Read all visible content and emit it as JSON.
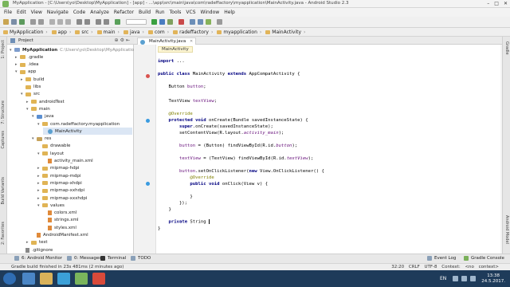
{
  "window": {
    "title": "MyApplication - [C:\\Users\\yo\\Desktop\\MyApplication] - [app] - ...\\app\\src\\main\\java\\com\\radeffactory\\myapplication\\MainActivity.java - Android Studio 2.3"
  },
  "menu": [
    "File",
    "Edit",
    "View",
    "Navigate",
    "Code",
    "Analyze",
    "Refactor",
    "Build",
    "Run",
    "Tools",
    "VCS",
    "Window",
    "Help"
  ],
  "breadcrumb": [
    "MyApplication",
    "app",
    "src",
    "main",
    "java",
    "com",
    "radeffactory",
    "myapplication",
    "MainActivity"
  ],
  "project_panel": {
    "header": "Project",
    "tree": [
      {
        "label": "MyApplication",
        "path": "C:\\Users\\yo\\Desktop\\MyApplication",
        "depth": 0,
        "type": "module",
        "arrow": "▾"
      },
      {
        "label": ".gradle",
        "depth": 1,
        "type": "folder",
        "arrow": "▸"
      },
      {
        "label": ".idea",
        "depth": 1,
        "type": "folder",
        "arrow": "▸"
      },
      {
        "label": "app",
        "depth": 1,
        "type": "folder",
        "arrow": "▾"
      },
      {
        "label": "build",
        "depth": 2,
        "type": "folder",
        "arrow": "▸"
      },
      {
        "label": "libs",
        "depth": 2,
        "type": "folder",
        "arrow": ""
      },
      {
        "label": "src",
        "depth": 2,
        "type": "folder",
        "arrow": "▾"
      },
      {
        "label": "androidTest",
        "depth": 3,
        "type": "folder",
        "arrow": "▸"
      },
      {
        "label": "main",
        "depth": 3,
        "type": "folder",
        "arrow": "▾"
      },
      {
        "label": "java",
        "depth": 4,
        "type": "java",
        "arrow": "▾"
      },
      {
        "label": "com.radeffactory.myapplication",
        "depth": 5,
        "type": "package",
        "arrow": "▾"
      },
      {
        "label": "MainActivity",
        "depth": 6,
        "type": "class",
        "arrow": "",
        "selected": true
      },
      {
        "label": "res",
        "depth": 4,
        "type": "res",
        "arrow": "▾"
      },
      {
        "label": "drawable",
        "depth": 5,
        "type": "folder",
        "arrow": ""
      },
      {
        "label": "layout",
        "depth": 5,
        "type": "folder",
        "arrow": "▾"
      },
      {
        "label": "activity_main.xml",
        "depth": 6,
        "type": "xml",
        "arrow": ""
      },
      {
        "label": "mipmap-hdpi",
        "depth": 5,
        "type": "folder",
        "arrow": "▸"
      },
      {
        "label": "mipmap-mdpi",
        "depth": 5,
        "type": "folder",
        "arrow": "▸"
      },
      {
        "label": "mipmap-xhdpi",
        "depth": 5,
        "type": "folder",
        "arrow": "▸"
      },
      {
        "label": "mipmap-xxhdpi",
        "depth": 5,
        "type": "folder",
        "arrow": "▸"
      },
      {
        "label": "mipmap-xxxhdpi",
        "depth": 5,
        "type": "folder",
        "arrow": "▸"
      },
      {
        "label": "values",
        "depth": 5,
        "type": "folder",
        "arrow": "▾"
      },
      {
        "label": "colors.xml",
        "depth": 6,
        "type": "xml",
        "arrow": ""
      },
      {
        "label": "strings.xml",
        "depth": 6,
        "type": "xml",
        "arrow": ""
      },
      {
        "label": "styles.xml",
        "depth": 6,
        "type": "xml",
        "arrow": ""
      },
      {
        "label": "AndroidManifest.xml",
        "depth": 4,
        "type": "xml",
        "arrow": ""
      },
      {
        "label": "test",
        "depth": 3,
        "type": "folder",
        "arrow": "▸"
      },
      {
        "label": ".gitignore",
        "depth": 2,
        "type": "git",
        "arrow": ""
      }
    ]
  },
  "editor": {
    "tab": "MainActivity.java",
    "context_tag": "MainActivity",
    "lines": [
      {
        "html": "<span class='kw'>import</span> ..."
      },
      {
        "html": ""
      },
      {
        "html": "<span class='kw'>public class</span> MainActivity <span class='kw'>extends</span> AppCompatActivity {"
      },
      {
        "html": ""
      },
      {
        "html": "    Button <span class='fd'>button</span>;"
      },
      {
        "html": ""
      },
      {
        "html": "    TextView <span class='fd'>textView</span>;"
      },
      {
        "html": ""
      },
      {
        "html": "    <span class='an'>@Override</span>"
      },
      {
        "html": "    <span class='kw'>protected void</span> onCreate(Bundle savedInstanceState) {"
      },
      {
        "html": "        <span class='kw'>super</span>.onCreate(savedInstanceState);"
      },
      {
        "html": "        setContentView(R.layout.<span class='st'>activity_main</span>);"
      },
      {
        "html": ""
      },
      {
        "html": "        <span class='fd'>button</span> = (Button) findViewById(R.id.<span class='st'>button</span>);"
      },
      {
        "html": ""
      },
      {
        "html": "        <span class='fd'>textView</span> = (TextView) findViewById(R.id.<span class='st'>textView</span>);"
      },
      {
        "html": ""
      },
      {
        "html": "        <span class='fd'>button</span>.setOnClickListener(<span class='kw'>new</span> View.OnClickListener() {"
      },
      {
        "html": "            <span class='an'>@Override</span>"
      },
      {
        "html": "            <span class='kw'>public void</span> onClick(View v) {"
      },
      {
        "html": ""
      },
      {
        "html": "            }"
      },
      {
        "html": "        });"
      },
      {
        "html": "    }"
      },
      {
        "html": "    <span class='kw'>private</span> String <span class='cursor'></span>"
      },
      {
        "html": "}"
      }
    ]
  },
  "bottom_tools": {
    "left": [
      "6: Android Monitor",
      "0: Messages",
      "Terminal",
      "TODO"
    ],
    "right": [
      "Event Log",
      "Gradle Console"
    ]
  },
  "status": {
    "message": "Gradle build finished in 23s 481ms (2 minutes ago)",
    "position": "32:20",
    "line_sep": "CRLF",
    "encoding": "UTF-8",
    "context": "Context: <no context>"
  },
  "taskbar": {
    "language": "EN",
    "time": "13:38",
    "date": "24.5.2017."
  },
  "side_labels": {
    "left": [
      "1: Project",
      "7: Structure",
      "Captures",
      "Build Variants",
      "2: Favorites"
    ],
    "right": [
      "Gradle",
      "Android Model"
    ]
  }
}
